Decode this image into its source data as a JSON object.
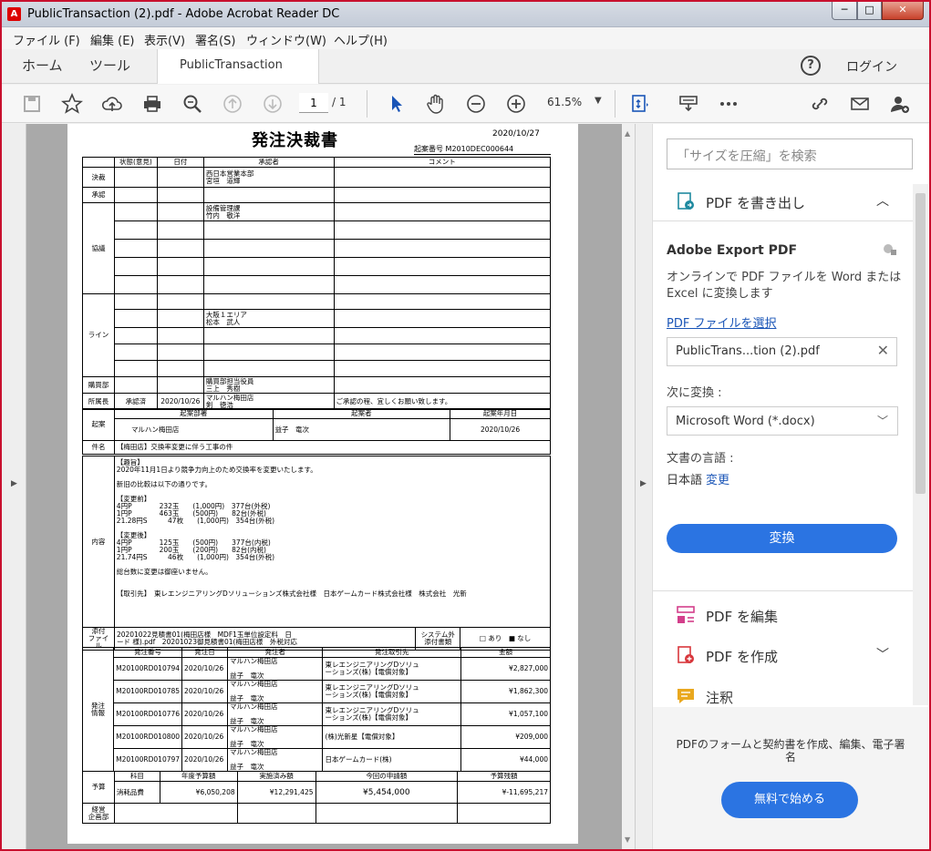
{
  "window": {
    "title": "PublicTransaction (2).pdf - Adobe Acrobat Reader DC",
    "min": "─",
    "max": "□",
    "close": "✕"
  },
  "menu": [
    "ファイル (F)",
    "編集 (E)",
    "表示(V)",
    "署名(S)",
    "ウィンドウ(W)",
    "ヘルプ(H)"
  ],
  "tabs": {
    "home": "ホーム",
    "tools": "ツール",
    "doc": "PublicTransaction (2)...",
    "close": "×"
  },
  "help": "?",
  "login": "ログイン",
  "toolbar": {
    "page": "1",
    "of": "/ 1",
    "zoom": "61.5%",
    "zoom_arrow": "▼"
  },
  "panel": {
    "search_placeholder": "「サイズを圧縮」を検索",
    "export_label": "PDF を書き出し",
    "export_title": "Adobe Export PDF",
    "export_desc": "オンラインで PDF ファイルを Word または Excel に変換します",
    "select_link": "PDF ファイルを選択",
    "file_name": "PublicTrans...tion (2).pdf",
    "convert_to_label": "次に変換 :",
    "convert_to_value": "Microsoft Word (*.docx)",
    "lang_label": "文書の言語 :",
    "lang_value": "日本語",
    "lang_change": "変更",
    "convert_button": "変換",
    "edit_label": "PDF を編集",
    "create_label": "PDF を作成",
    "comment_label": "注釈",
    "promo_text": "PDFのフォームと契約書を作成、編集、電子署名",
    "promo_button": "無料で始める"
  },
  "doc": {
    "title": "発注決裁書",
    "date": "2020/10/27",
    "number": "起案番号 M2010DEC000644",
    "h": {
      "status": "状態(意見)",
      "date": "日付",
      "approver": "承認者",
      "comment": "コメント"
    },
    "rows": {
      "kessai": "決裁",
      "shonin": "承認",
      "kyogi": "協議",
      "line": "ライン",
      "kobai": "購買部",
      "shozoku": "所属長"
    },
    "kessai_person": "西日本営業本部\n宮垣　道輝",
    "kyogi_person": "設備管理課\n竹内　敬洋",
    "line_person": "大阪１エリア\n松本　武人",
    "kobai_person": "購買部担当役員\n三上　秀樹",
    "shozoku_status": "承認済",
    "shozoku_date": "2020/10/26",
    "shozoku_person": "マルハン梅田店\n剣　徳浩",
    "shozoku_comment": "ご承認の程、宜しくお願い致します。",
    "kian": {
      "label": "起案",
      "dept_h": "起案部署",
      "person_h": "起案者",
      "date_h": "起案年月日",
      "dept": "マルハン梅田店",
      "person": "益子　竜次",
      "date": "2020/10/26"
    },
    "kenmei": {
      "label": "件名",
      "value": "【梅田店】交換率変更に伴う工事の件"
    },
    "naiyo": {
      "label": "内容",
      "lines": [
        "【趣旨】",
        "2020年11月1日より競争力向上のため交換率を変更いたします。",
        "",
        "新旧の比較は以下の通りです。",
        "",
        "【変更前】",
        "4円P　　　　232玉　　(1,000円)　377台(外税)",
        "1円P　　　　463玉　　(500円)　　82台(外税)",
        "21.28円S　　　47枚　　(1,000円)　354台(外税)",
        "",
        "【変更後】",
        "4円P　　　　125玉　　(500円)　　377台(内税)",
        "1円P　　　　200玉　　(200円)　　82台(内税)",
        "21.74円S　　　46枚　　(1,000円)　354台(外税)",
        "",
        "総台数に変更は御座いません。",
        "",
        "",
        "【取引先】　東レエンジニアリングDソリューションズ株式会社様　日本ゲームカード株式会社様　株式会社　光新"
      ]
    },
    "tenpu": {
      "label": "添付\nファイル",
      "value": "20201022見積書01(梅田店様　MDF1玉単位設定料　日\nード 様).pdf　20201023御見積書01(梅田店様　外税対応",
      "sys_label": "システム外\n添付書類",
      "sys_value": "□ あり　■ なし"
    },
    "hatchu": {
      "label": "発注\n情報",
      "h": [
        "発注番号",
        "発注日",
        "発注者",
        "発注取引先",
        "金額"
      ],
      "rows": [
        [
          "M20100RD010794",
          "2020/10/26",
          "マルハン梅田店\n\n益子　竜次",
          "東レエンジニアリングDソリュ\nーションズ(株)【電償対象】",
          "¥2,827,000"
        ],
        [
          "M20100RD010785",
          "2020/10/26",
          "マルハン梅田店\n\n益子　竜次",
          "東レエンジニアリングDソリュ\nーションズ(株)【電償対象】",
          "¥1,862,300"
        ],
        [
          "M20100RD010776",
          "2020/10/26",
          "マルハン梅田店\n\n益子　竜次",
          "東レエンジニアリングDソリュ\nーションズ(株)【電償対象】",
          "¥1,057,100"
        ],
        [
          "M20100RD010800",
          "2020/10/26",
          "マルハン梅田店\n\n益子　竜次",
          "(株)光新星【電償対象】",
          "¥209,000"
        ],
        [
          "M20100RD010797",
          "2020/10/26",
          "マルハン梅田店\n\n益子　竜次",
          "日本ゲームカード(株)",
          "¥44,000"
        ]
      ]
    },
    "yosan": {
      "label": "予算",
      "h": [
        "科目",
        "年度予算額",
        "実施済み額",
        "今回の申請額",
        "予算残額"
      ],
      "row": [
        "消耗品費",
        "¥6,050,208",
        "¥12,291,425",
        "¥5,454,000",
        "¥-11,695,217"
      ]
    },
    "keiei": "経営\n企画部"
  }
}
